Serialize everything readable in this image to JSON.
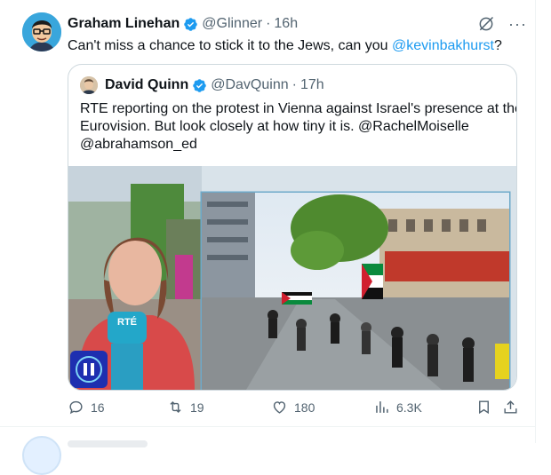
{
  "tweet": {
    "author_name": "Graham Linehan",
    "handle": "@Glinner",
    "separator": "·",
    "time": "16h",
    "text_prefix": "Can't miss a chance to stick it to the Jews, can you ",
    "text_mention": "@kevinbakhurst",
    "text_suffix": "?",
    "more_label": "···"
  },
  "quote": {
    "author_name": "David Quinn",
    "handle": "@DavQuinn",
    "separator": "·",
    "time": "17h",
    "lines": [
      "RTE reporting on the protest in Vienna against Israel's presence at the",
      "Eurovision. But look closely at how tiny it is. @RachelMoiselle",
      "@abrahamson_ed"
    ],
    "media_logo": "RTÉ"
  },
  "actions": {
    "replies": "16",
    "reposts": "19",
    "likes": "180",
    "views": "6.3K"
  },
  "colors": {
    "accent": "#1d9bf0",
    "muted": "#536471",
    "border": "#cfd9de"
  },
  "icons": [
    "verified-badge-icon",
    "grok-icon",
    "more-icon",
    "reply-icon",
    "repost-icon",
    "like-icon",
    "views-icon",
    "bookmark-icon",
    "share-icon",
    "pause-icon"
  ]
}
